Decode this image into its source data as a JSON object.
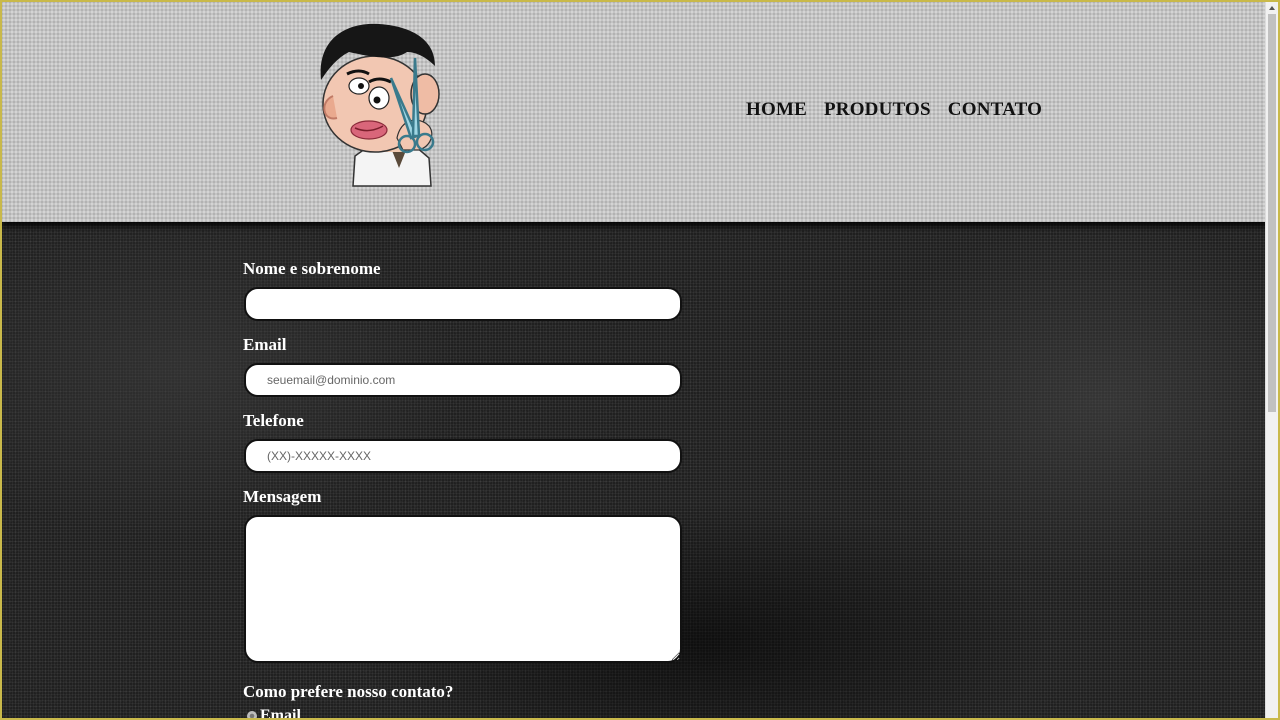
{
  "header": {
    "logo_alt": "Mr. Bean barber logo",
    "nav": [
      {
        "label": "HOME"
      },
      {
        "label": "PRODUTOS"
      },
      {
        "label": "CONTATO"
      }
    ]
  },
  "form": {
    "name_label": "Nome e sobrenome",
    "name_value": "",
    "email_label": "Email",
    "email_placeholder": "seuemail@dominio.com",
    "phone_label": "Telefone",
    "phone_placeholder": "(XX)-XXXXX-XXXX",
    "message_label": "Mensagem",
    "message_value": "",
    "contact_pref_label": "Como prefere nosso contato?",
    "contact_options": [
      {
        "label": "Email",
        "selected": true
      }
    ]
  },
  "colors": {
    "header_bg": "#c4c4c4",
    "main_bg": "#202020",
    "label_text": "#ffffff",
    "nav_text": "#111111"
  }
}
